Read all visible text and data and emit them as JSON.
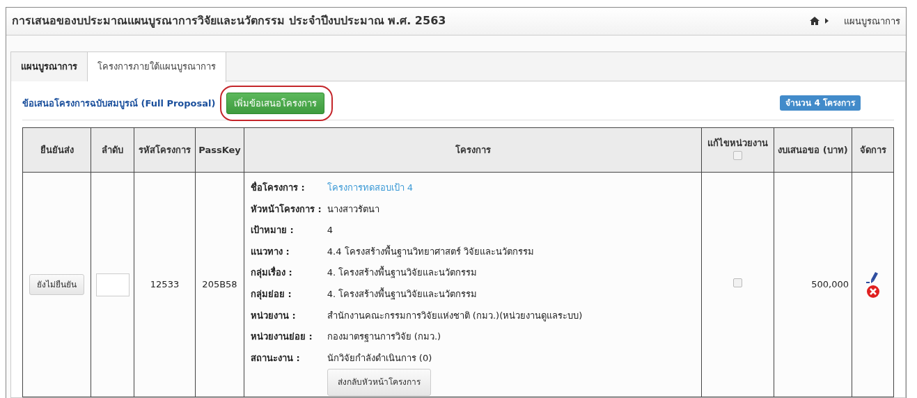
{
  "header": {
    "title": "การเสนอของบประมาณแผนบูรณาการวิจัยและนวัตกรรม ประจำปีงบประมาณ พ.ศ. 2563",
    "breadcrumb": [
      {
        "label": "แผนบูรณาการ"
      }
    ]
  },
  "tabs": [
    {
      "label": "แผนบูรณาการ",
      "selected": false
    },
    {
      "label": "โครงการภายใต้แผนบูรณาการ",
      "selected": true
    }
  ],
  "section": {
    "title": "ข้อเสนอโครงการฉบับสมบูรณ์ (Full Proposal)",
    "add_button": {
      "label": "เพิ่มข้อเสนอโครงการ",
      "highlighted": true
    },
    "count_badge": "จำนวน 4 โครงการ"
  },
  "table": {
    "columns": [
      {
        "label": "ยืนยันส่ง"
      },
      {
        "label": "ลำดับ"
      },
      {
        "label": "รหัสโครงการ"
      },
      {
        "label": "PassKey"
      },
      {
        "label": "โครงการ"
      },
      {
        "label": "แก้ไขหน่วยงาน",
        "checked": false
      },
      {
        "label": "งบเสนอขอ (บาท)"
      },
      {
        "label": "จัดการ"
      }
    ],
    "rows": [
      {
        "confirm_button": "ยังไม่ยืนยัน",
        "order": "",
        "project_code": "12533",
        "passkey": "205B58",
        "details": [
          {
            "label": "ชื่อโครงการ :",
            "value": "โครงการทดสอบเป้า 4",
            "kind": "link"
          },
          {
            "label": "หัวหน้าโครงการ :",
            "value": "นางสาวรัตนา",
            "kind": "text"
          },
          {
            "label": "เป้าหมาย :",
            "value": "4",
            "kind": "text"
          },
          {
            "label": "แนวทาง :",
            "value": "4.4 โครงสร้างพื้นฐานวิทยาศาสตร์ วิจัยและนวัตกรรม",
            "kind": "text"
          },
          {
            "label": "กลุ่มเรื่อง :",
            "value": "4. โครงสร้างพื้นฐานวิจัยและนวัตกรรม",
            "kind": "text"
          },
          {
            "label": "กลุ่มย่อย :",
            "value": "4. โครงสร้างพื้นฐานวิจัยและนวัตกรรม",
            "kind": "text"
          },
          {
            "label": "หน่วยงาน :",
            "value": "สำนักงานคณะกรรมการวิจัยแห่งชาติ (กมว.)(หน่วยงานดูแลระบบ)",
            "kind": "text"
          },
          {
            "label": "หน่วยงานย่อย :",
            "value": "กองมาตรฐานการวิจัย (กมว.)",
            "kind": "text"
          },
          {
            "label": "สถานะงาน :",
            "value": "นักวิจัยกำลังดำเนินการ (0)",
            "kind": "text"
          }
        ],
        "send_back_button": "ส่งกลับหัวหน้าโครงการ",
        "edit_unit_checked": false,
        "budget": "500,000"
      }
    ]
  }
}
